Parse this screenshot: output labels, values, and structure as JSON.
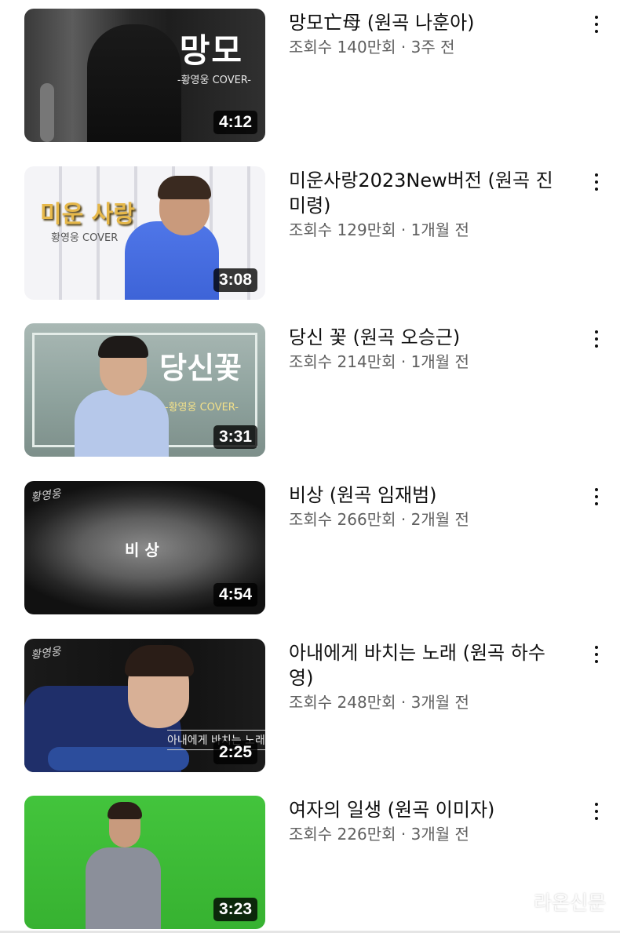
{
  "videos": [
    {
      "title": "망모亡母 (원곡 나훈아)",
      "stats": "조회수 140만회 · 3주 전",
      "duration": "4:12",
      "thumb_text": "망모",
      "thumb_subtext": "-황영웅 COVER-"
    },
    {
      "title": "미운사랑2023New버전 (원곡 진미령)",
      "stats": "조회수 129만회 · 1개월 전",
      "duration": "3:08",
      "thumb_text": "미운 사랑",
      "thumb_subtext": "황영웅 COVER"
    },
    {
      "title": "당신 꽃 (원곡 오승근)",
      "stats": "조회수 214만회 · 1개월 전",
      "duration": "3:31",
      "thumb_text": "당신꽃",
      "thumb_subtext": "-황영웅 COVER-"
    },
    {
      "title": "비상 (원곡 임재범)",
      "stats": "조회수 266만회 · 2개월 전",
      "duration": "4:54",
      "thumb_text": "비 상",
      "thumb_subtext": "황영웅"
    },
    {
      "title": "아내에게 바치는 노래 (원곡 하수영)",
      "stats": "조회수 248만회 · 3개월 전",
      "duration": "2:25",
      "thumb_text": "아내에게 바치는 노래",
      "thumb_subtext": "황영웅"
    },
    {
      "title": "여자의 일생 (원곡 이미자)",
      "stats": "조회수 226만회 · 3개월 전",
      "duration": "3:23",
      "thumb_text": "",
      "thumb_subtext": ""
    }
  ],
  "watermark": "라온신문",
  "icons": {
    "more": "more-vert-icon",
    "watermark": "music-note-icon"
  },
  "colors": {
    "title": "#0f0f0f",
    "stats": "#606060",
    "green_screen": "#3fbf3a"
  }
}
